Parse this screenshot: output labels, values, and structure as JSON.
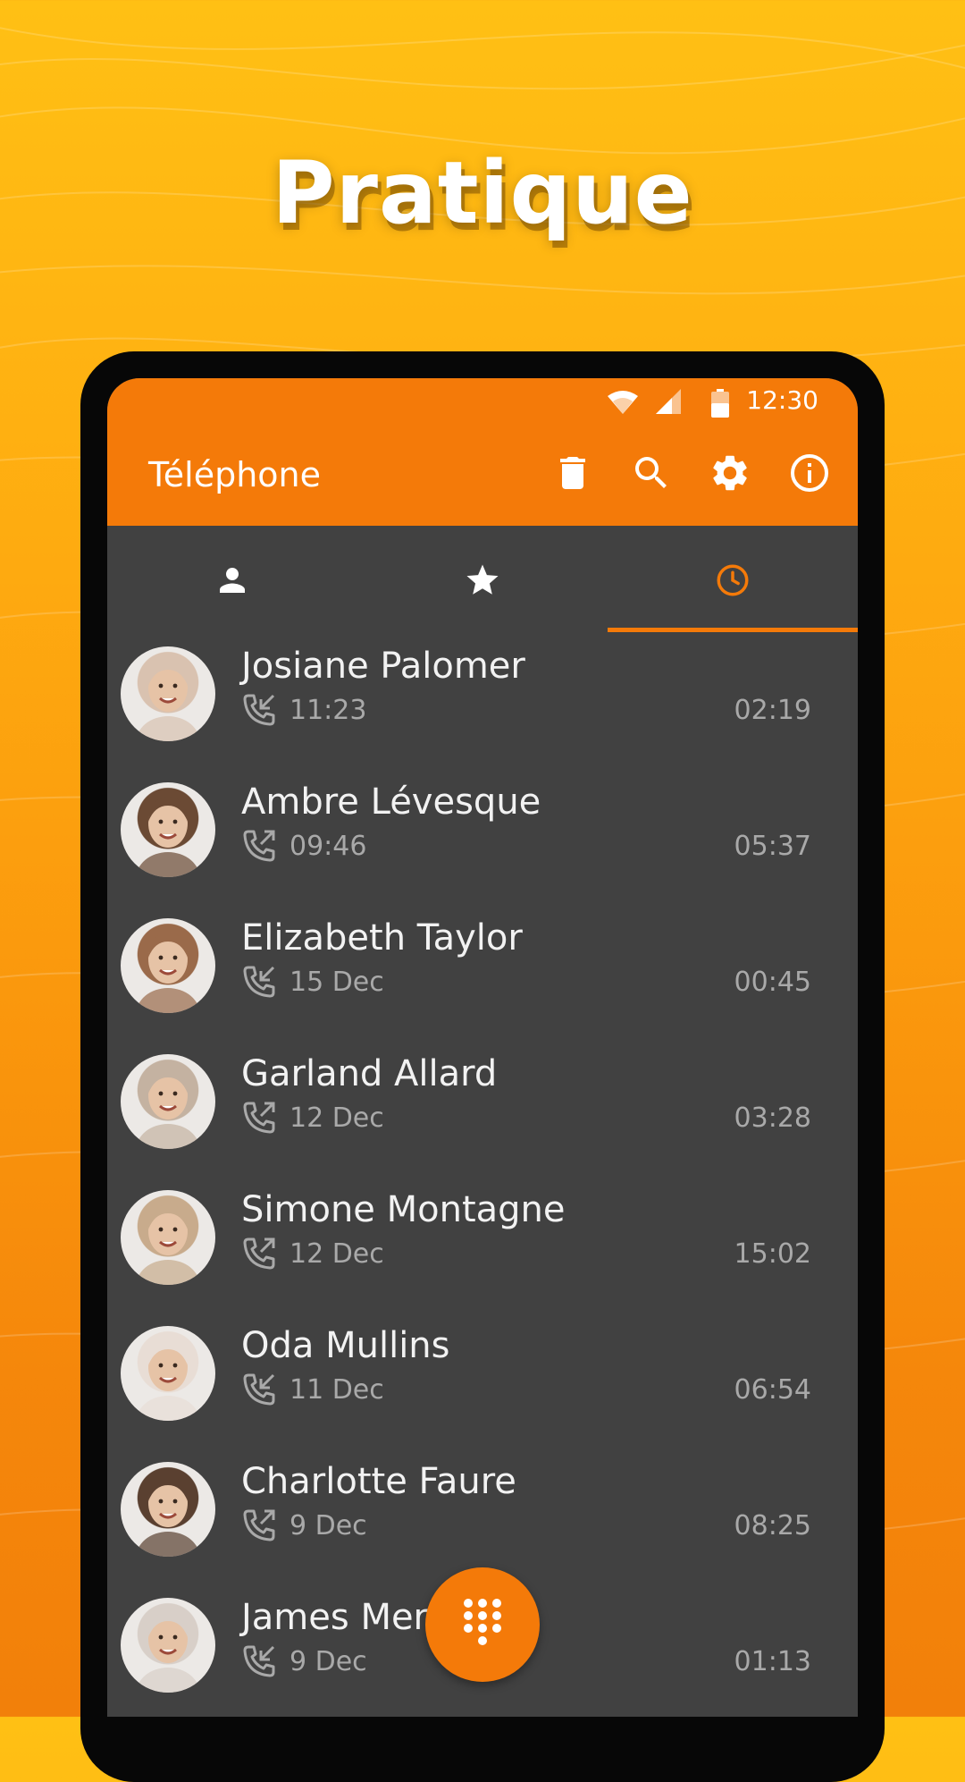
{
  "headline": "Pratique",
  "status_bar": {
    "time": "12:30"
  },
  "app_bar": {
    "title": "Téléphone",
    "actions": [
      "delete-icon",
      "search-icon",
      "settings-icon",
      "info-icon"
    ]
  },
  "tabs": [
    {
      "icon": "person-icon",
      "selected": false
    },
    {
      "icon": "star-icon",
      "selected": false
    },
    {
      "icon": "clock-icon",
      "selected": true
    }
  ],
  "calls": [
    {
      "name": "Josiane Palomer",
      "direction": "incoming",
      "when": "11:23",
      "duration": "02:19",
      "avatar_color": "#d9c2b0"
    },
    {
      "name": "Ambre Lévesque",
      "direction": "outgoing",
      "when": "09:46",
      "duration": "05:37",
      "avatar_color": "#6b4a34"
    },
    {
      "name": "Elizabeth Taylor",
      "direction": "incoming",
      "when": "15 Dec",
      "duration": "00:45",
      "avatar_color": "#9a6a4a"
    },
    {
      "name": "Garland Allard",
      "direction": "outgoing",
      "when": "12 Dec",
      "duration": "03:28",
      "avatar_color": "#c4b2a1"
    },
    {
      "name": "Simone Montagne",
      "direction": "outgoing",
      "when": "12 Dec",
      "duration": "15:02",
      "avatar_color": "#c8ab8c"
    },
    {
      "name": "Oda Mullins",
      "direction": "incoming",
      "when": "11 Dec",
      "duration": "06:54",
      "avatar_color": "#e8ddd5"
    },
    {
      "name": "Charlotte Faure",
      "direction": "outgoing",
      "when": "9 Dec",
      "duration": "08:25",
      "avatar_color": "#5a4030"
    },
    {
      "name": "James Mer",
      "direction": "incoming",
      "when": "9 Dec",
      "duration": "01:13",
      "avatar_color": "#d8cfc8"
    }
  ],
  "fab": {
    "icon": "dialpad-icon"
  },
  "colors": {
    "accent": "#f47a09",
    "list_bg": "#414141",
    "text_primary": "#f2f2f2",
    "text_secondary": "#a9a9a9"
  }
}
